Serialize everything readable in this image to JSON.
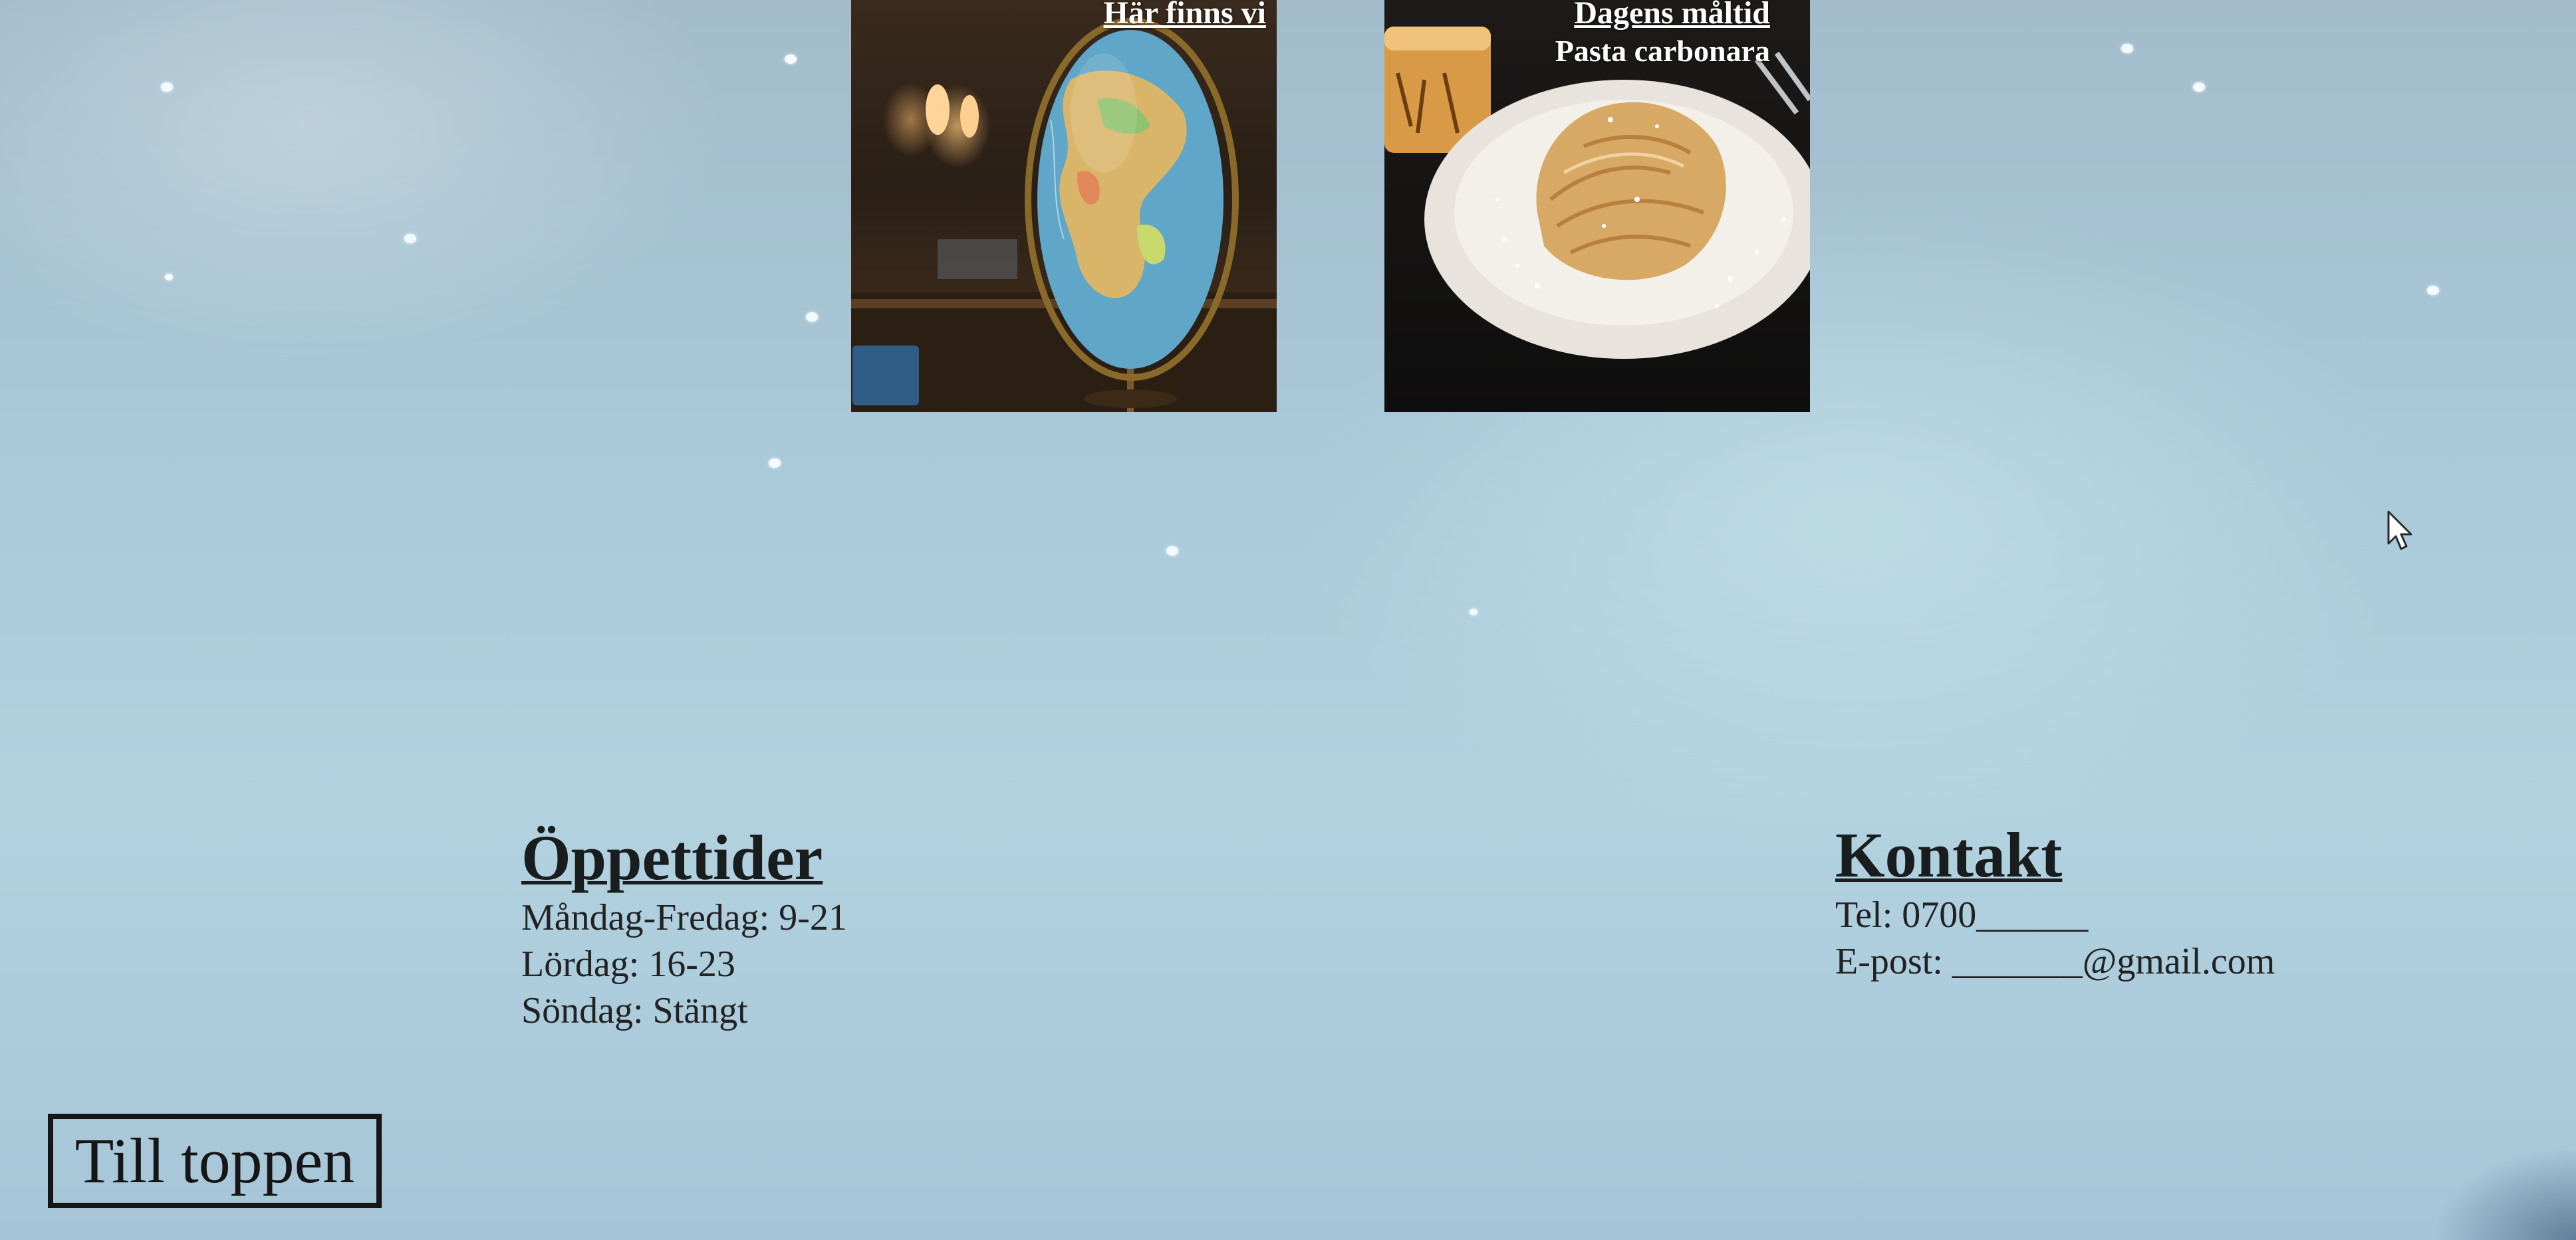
{
  "tiles": {
    "location": {
      "caption": "Här finns vi"
    },
    "meal": {
      "caption": "Dagens måltid",
      "dish": "Pasta carbonara"
    }
  },
  "opening_hours": {
    "heading": "Öppettider",
    "lines": [
      "Måndag-Fredag: 9-21",
      "Lördag: 16-23",
      "Söndag: Stängt"
    ]
  },
  "contact": {
    "heading": "Kontakt",
    "phone": "Tel: 0700______",
    "email": "E-post: _______@gmail.com"
  },
  "top_button": {
    "label": "Till toppen"
  },
  "icons": {
    "cursor": "mouse-pointer-icon"
  },
  "colors": {
    "background": "#aac8d8",
    "heading_text": "#1a1d1d",
    "tile_caption": "#ffffff"
  }
}
